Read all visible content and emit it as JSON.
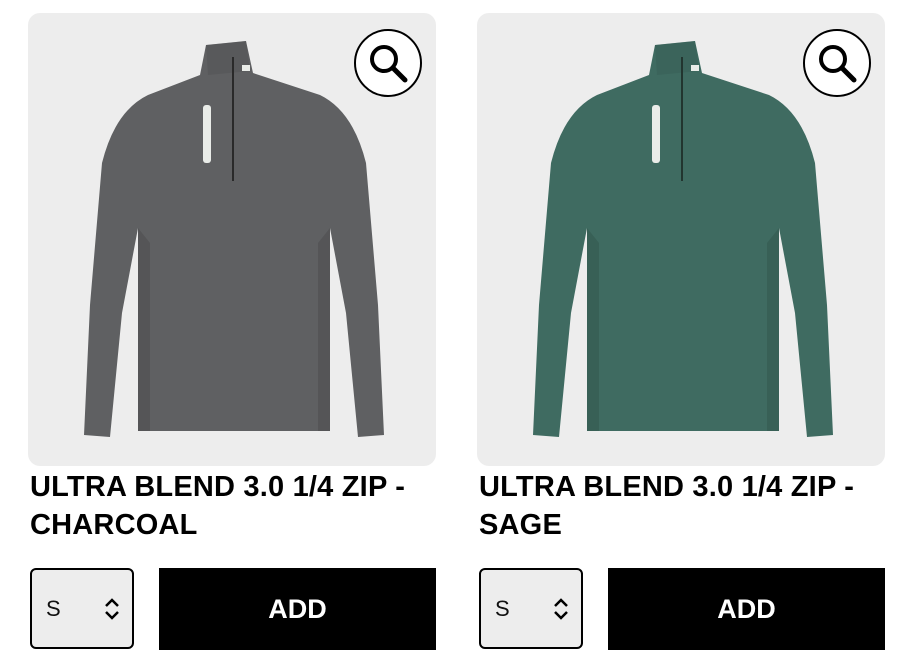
{
  "products": [
    {
      "title_line1": "ULTRA BLEND 3.0 1/4 ZIP -",
      "title_line2": "CHARCOAL",
      "size": "S",
      "add_label": "ADD",
      "color": "#5f6062",
      "shade": "#4c4d4f",
      "zoom_icon": "magnifier-icon"
    },
    {
      "title_line1": "ULTRA BLEND 3.0 1/4 ZIP -",
      "title_line2": "SAGE",
      "size": "S",
      "add_label": "ADD",
      "color": "#3f6b61",
      "shade": "#33584f",
      "zoom_icon": "magnifier-icon"
    }
  ]
}
